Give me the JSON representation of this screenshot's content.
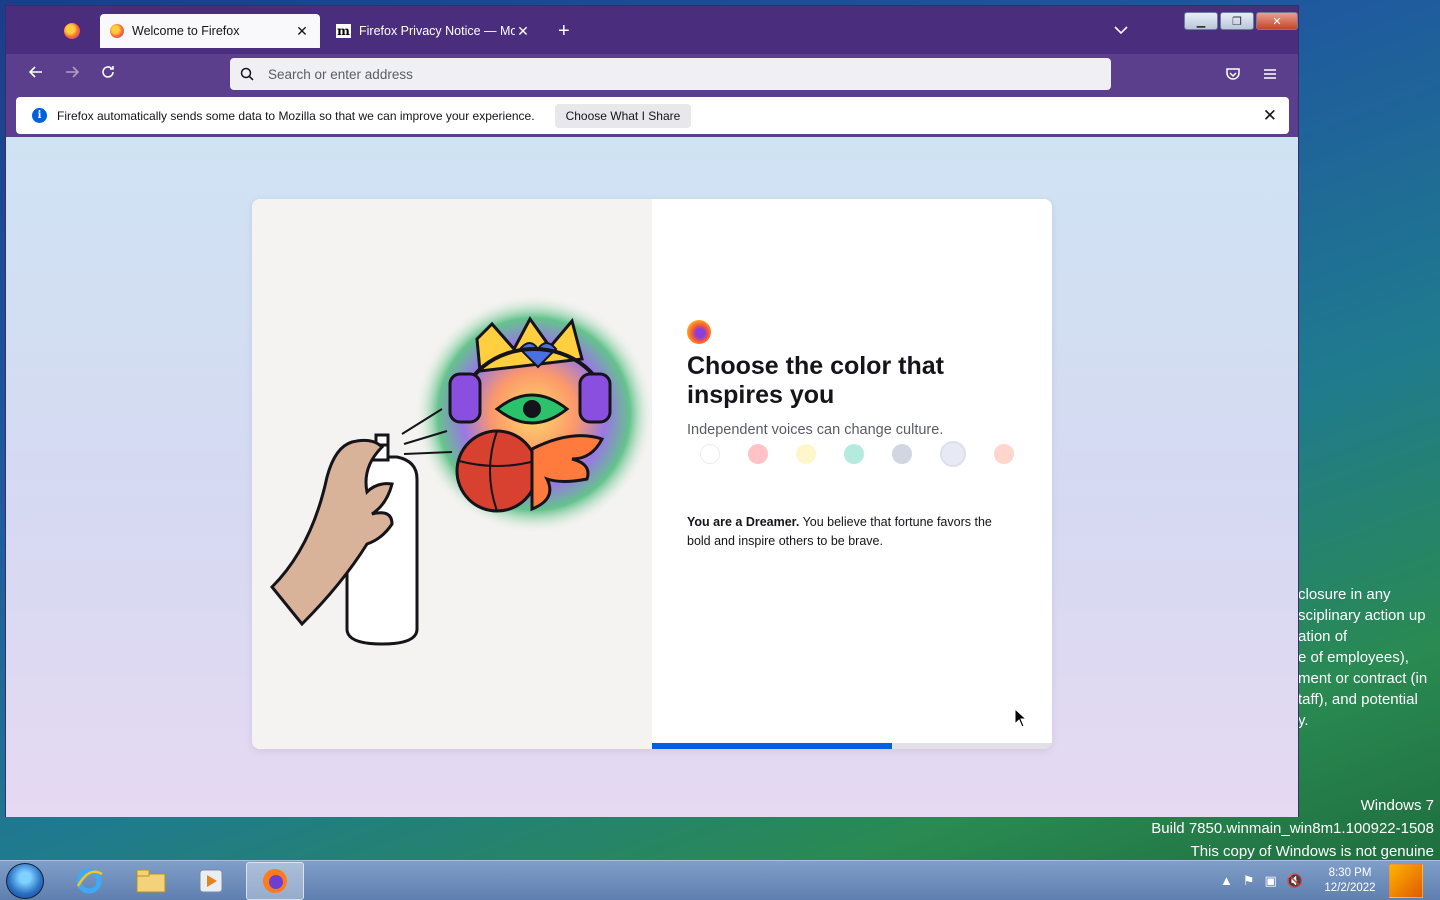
{
  "desktop": {
    "legal_lines": [
      "closure in any",
      "sciplinary action up",
      "ation of",
      "e of employees),",
      "ment or contract (in",
      "taff), and potential",
      "y."
    ],
    "watermark": {
      "line1": "Windows 7",
      "line2": "Build 7850.winmain_win8m1.100922-1508",
      "line3": "This copy of Windows is not genuine"
    }
  },
  "browser": {
    "tabs": [
      {
        "title": "Welcome to Firefox",
        "active": true
      },
      {
        "title": "Firefox Privacy Notice — Mozilla",
        "active": false
      }
    ],
    "urlbar": {
      "placeholder": "Search or enter address",
      "value": ""
    },
    "notification": {
      "text": "Firefox automatically sends some data to Mozilla so that we can improve your experience.",
      "button": "Choose What I Share"
    }
  },
  "onboarding": {
    "heading": "Choose the color that inspires you",
    "subtitle": "Independent voices can change culture.",
    "swatches": [
      "#ffffff",
      "#ff4f5e",
      "#ffe66d",
      "#2ac3a2",
      "#7a8aa8",
      "#d8dcf0",
      "#ff8a6b"
    ],
    "selected_swatch_index": 5,
    "result_bold": "You are a Dreamer.",
    "result_text": " You believe that fortune favors the bold and inspire others to be brave.",
    "progress": 0.6
  },
  "taskbar": {
    "clock_time": "8:30 PM",
    "clock_date": "12/2/2022"
  }
}
